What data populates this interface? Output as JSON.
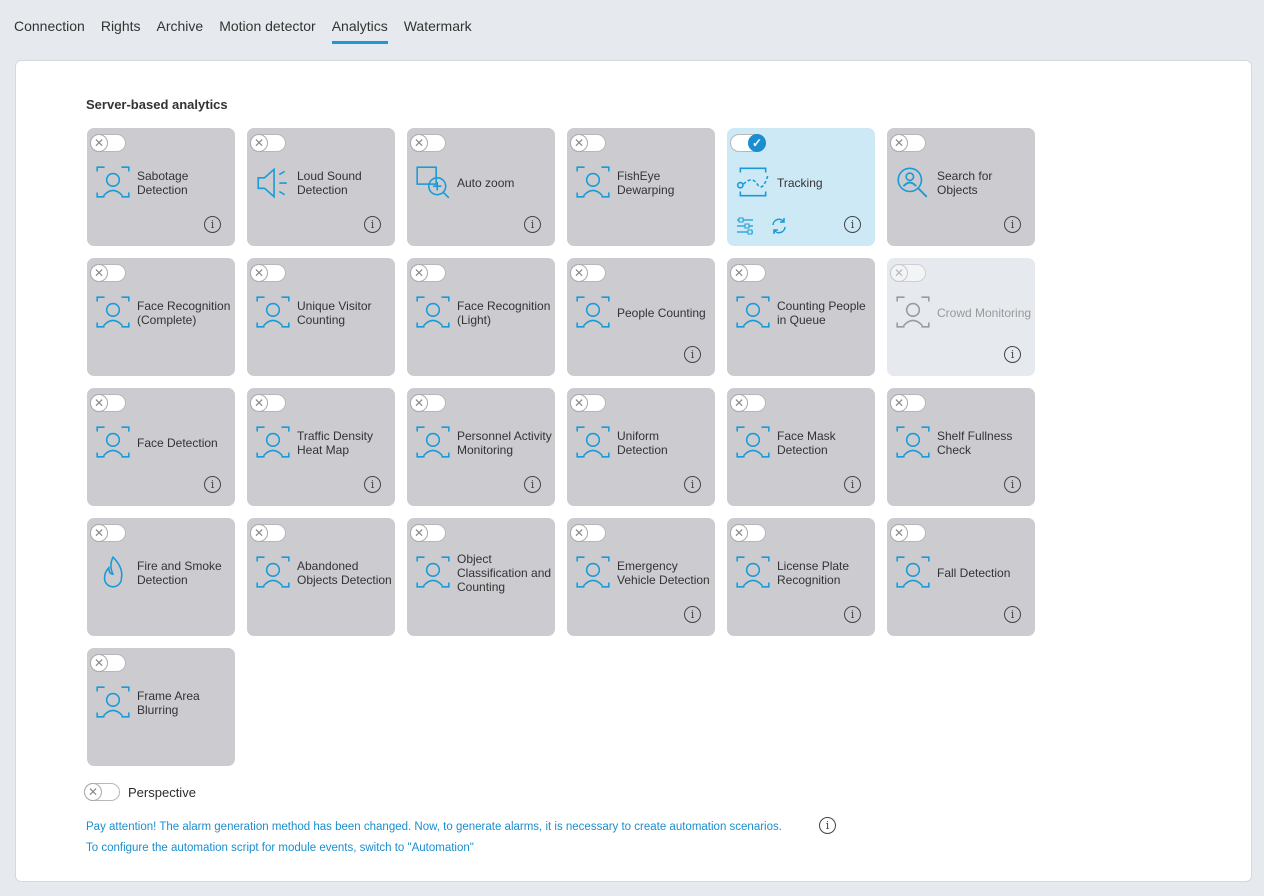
{
  "tabs": [
    {
      "label": "Connection"
    },
    {
      "label": "Rights"
    },
    {
      "label": "Archive"
    },
    {
      "label": "Motion detector"
    },
    {
      "label": "Analytics",
      "active": true
    },
    {
      "label": "Watermark"
    }
  ],
  "section_title": "Server-based analytics",
  "accent_color": "#1a9bd7",
  "modules": [
    {
      "label": "Sabotage Detection",
      "icon": "camera-sabotage-icon",
      "enabled": false,
      "info": true
    },
    {
      "label": "Loud Sound Detection",
      "icon": "speaker-icon",
      "enabled": false,
      "info": true
    },
    {
      "label": "Auto zoom",
      "icon": "zoom-in-icon",
      "enabled": false,
      "info": true
    },
    {
      "label": "FishEye Dewarping",
      "icon": "panorama-icon",
      "enabled": false,
      "info": false
    },
    {
      "label": "Tracking",
      "icon": "tracking-icon",
      "enabled": true,
      "info": true,
      "tools": true
    },
    {
      "label": "Search for Objects",
      "icon": "search-person-icon",
      "enabled": false,
      "info": true
    },
    {
      "label": "Face Recognition (Complete)",
      "icon": "face-icon",
      "enabled": false,
      "info": false
    },
    {
      "label": "Unique Visitor Counting",
      "icon": "bar-chart-icon",
      "enabled": false,
      "info": false
    },
    {
      "label": "Face Recognition (Light)",
      "icon": "face-icon",
      "enabled": false,
      "info": false
    },
    {
      "label": "People Counting",
      "icon": "people-count-icon",
      "enabled": false,
      "info": true
    },
    {
      "label": "Counting People in Queue",
      "icon": "queue-icon",
      "enabled": false,
      "info": false
    },
    {
      "label": "Crowd Monitoring",
      "icon": "crowd-icon",
      "enabled": false,
      "info": true,
      "disabled": true
    },
    {
      "label": "Face Detection",
      "icon": "face-icon",
      "enabled": false,
      "info": true
    },
    {
      "label": "Traffic Density Heat Map",
      "icon": "footprints-icon",
      "enabled": false,
      "info": true
    },
    {
      "label": "Personnel Activity Monitoring",
      "icon": "office-chair-icon",
      "enabled": false,
      "info": true
    },
    {
      "label": "Uniform Detection",
      "icon": "hard-hat-icon",
      "enabled": false,
      "info": true
    },
    {
      "label": "Face Mask Detection",
      "icon": "face-mask-icon",
      "enabled": false,
      "info": true
    },
    {
      "label": "Shelf Fullness Check",
      "icon": "shelf-icon",
      "enabled": false,
      "info": true
    },
    {
      "label": "Fire and Smoke Detection",
      "icon": "fire-icon",
      "enabled": false,
      "info": false
    },
    {
      "label": "Abandoned Objects Detection",
      "icon": "suitcase-icon",
      "enabled": false,
      "info": false
    },
    {
      "label": "Object Classification and Counting",
      "icon": "vehicle-classification-icon",
      "enabled": false,
      "info": false
    },
    {
      "label": "Emergency Vehicle Detection",
      "icon": "ambulance-icon",
      "enabled": false,
      "info": true
    },
    {
      "label": "License Plate Recognition",
      "icon": "car-icon",
      "enabled": false,
      "info": true
    },
    {
      "label": "Fall Detection",
      "icon": "falling-person-icon",
      "enabled": false,
      "info": true
    },
    {
      "label": "Frame Area Blurring",
      "icon": "blur-icon",
      "enabled": false,
      "info": false
    }
  ],
  "perspective": {
    "label": "Perspective",
    "enabled": false
  },
  "notice": {
    "line1": "Pay attention! The alarm generation method has been changed. Now, to generate alarms, it is necessary to create automation scenarios.",
    "line2": "To configure the automation script for module events, switch to \"Automation\""
  }
}
